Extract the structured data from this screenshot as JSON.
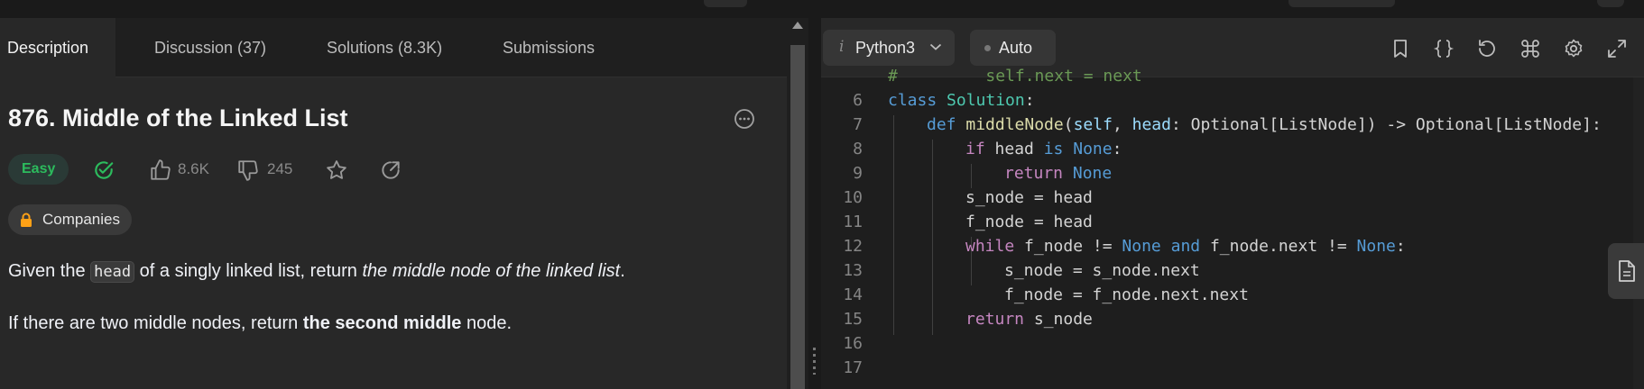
{
  "tabs": {
    "description": "Description",
    "discussion": "Discussion (37)",
    "solutions": "Solutions (8.3K)",
    "submissions": "Submissions"
  },
  "problem": {
    "title": "876. Middle of the Linked List",
    "difficulty": "Easy",
    "likes": "8.6K",
    "dislikes": "245",
    "companies": "Companies",
    "p1_before": "Given the ",
    "p1_code": "head",
    "p1_mid": " of a singly linked list, return ",
    "p1_italic": "the middle node of the linked list",
    "p1_end": ".",
    "p2_before": "If there are two middle nodes, return ",
    "p2_bold": "the second middle",
    "p2_end": " node."
  },
  "editor": {
    "language_glyph": "i",
    "language": "Python3",
    "mode": "Auto",
    "line_numbers": [
      "6",
      "7",
      "8",
      "9",
      "10",
      "11",
      "12",
      "13",
      "14",
      "15",
      "16",
      "17"
    ],
    "partial_top_line": "#         self.next = next",
    "code": {
      "l6_kw": "class",
      "l6_cls": "Solution",
      "l6_end": ":",
      "l7_kw": "def",
      "l7_fn": "middleNode",
      "l7_p1": "self",
      "l7_p2": "head",
      "l7_rest": ": Optional[ListNode]) -> Optional[ListNode]:",
      "l8_kw": "if",
      "l8_a": " head ",
      "l8_kw2": "is",
      "l8_none": " None",
      "l8_end": ":",
      "l9_kw": "return",
      "l9_none": " None",
      "l10": "s_node = head",
      "l11": "f_node = head",
      "l12_kw": "while",
      "l12_a": " f_node != ",
      "l12_none1": "None",
      "l12_and": " and",
      "l12_b": " f_node.next != ",
      "l12_none2": "None",
      "l12_end": ":",
      "l13": "s_node = s_node.next",
      "l14": "f_node = f_node.next.next",
      "l15_kw": "return",
      "l15_rest": " s_node"
    }
  },
  "colors": {
    "easy": "#2cbb5d",
    "accepted": "#2cbb5d",
    "lock": "#ffa116"
  }
}
